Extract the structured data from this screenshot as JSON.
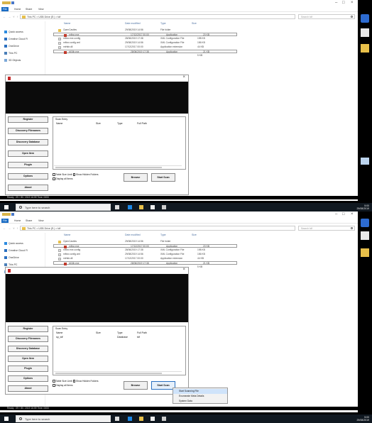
{
  "explorer": {
    "tabs": [
      "File",
      "Home",
      "Share",
      "View"
    ],
    "address_path": "This PC > USB Drive (E:) > tdf",
    "search_placeholder": "Search tdf",
    "nav_items_1": [
      "Quick access",
      "Creative Cloud Fi",
      "OneDrive",
      "This PC",
      "3D Objects"
    ],
    "nav_items_2": [
      "Quick access",
      "Creative Cloud Fi",
      "OneDrive",
      "This PC",
      "3D Objects"
    ],
    "columns": [
      "Name",
      "Date modified",
      "Type",
      "Size"
    ],
    "files": [
      {
        "name": "OpenCastles",
        "date": "29/08/2019 14:56",
        "type": "File folder",
        "size": ""
      },
      {
        "name": "mftrcr.exe",
        "date": "17/12/2017 00:00",
        "type": "Application",
        "size": "20 KB"
      },
      {
        "name": "mftrcr.exe.config",
        "date": "28/06/2019 17:38",
        "type": "XML Configuration File",
        "size": "198 KB"
      },
      {
        "name": "mftrcr.config.xml",
        "date": "29/08/2019 14:56",
        "type": "XML Configuration File",
        "size": "156 KB"
      },
      {
        "name": "mtrfstr.dll",
        "date": "17/12/2017 00:00",
        "type": "Application extension",
        "size": "44 KB"
      },
      {
        "name": "tdf-lth.exe",
        "date": "28/06/2019 17:38",
        "type": "Application",
        "size": "21 KB"
      },
      {
        "name": "",
        "date": "",
        "type": "",
        "size": "5 KB"
      }
    ]
  },
  "app": {
    "side_buttons": [
      "Register",
      "Discovery Filenames",
      "Discovery Database",
      "Open Item",
      "Plugin",
      "Options",
      "About"
    ],
    "panel_label": "Scan Entry",
    "table_headers": [
      "Name",
      "Size",
      "Type",
      "Full Path"
    ],
    "row2": {
      "name": "sp_tdf",
      "size": "",
      "type": "Database",
      "path": "tdf"
    },
    "check_1a": "Table Size Limit",
    "check_1b": "Show Hidden Folders",
    "check_2": "Display all Items",
    "browse_label": "Browse",
    "scan_label": "Start Scan",
    "context_menu": [
      "Start Scanning File",
      "Enumerate Meta Details",
      "System Data"
    ]
  },
  "status_1": "Ready  :  09 / 05 / 2019  16:59 Time: 0000",
  "status_2": "Ready  :  09 / 05 / 2019  16:59 Time: 0000",
  "taskbar": {
    "search_placeholder": "Type here to search",
    "time": "5:00",
    "date": "29/08/2019"
  },
  "colors": {
    "accent": "#1a6cc4",
    "taskbar": "#101820",
    "app_icon": "#c62828"
  }
}
